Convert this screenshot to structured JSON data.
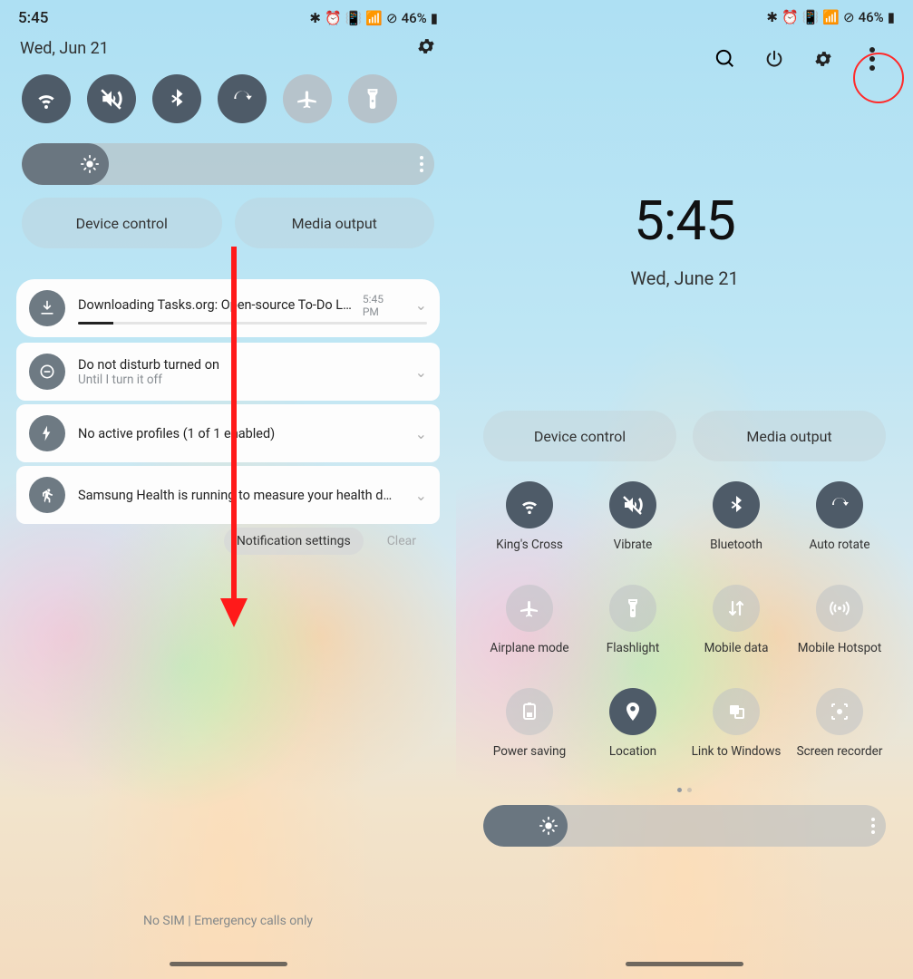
{
  "left": {
    "status": {
      "time": "5:45",
      "battery": "46%"
    },
    "date": "Wed, Jun 21",
    "toggles": [
      {
        "name": "wifi",
        "on": true
      },
      {
        "name": "sound",
        "on": true
      },
      {
        "name": "bluetooth",
        "on": true
      },
      {
        "name": "rotate",
        "on": true
      },
      {
        "name": "airplane",
        "on": false
      },
      {
        "name": "flashlight",
        "on": false
      }
    ],
    "pill_device": "Device control",
    "pill_media": "Media output",
    "notifications": [
      {
        "title": "Downloading Tasks.org: Open-source To-Do Lists &…",
        "time": "5:45 PM",
        "progress": 10
      },
      {
        "title": "Do not disturb turned on",
        "sub": "Until I turn it off"
      },
      {
        "title": "No active profiles (1 of 1 enabled)"
      },
      {
        "title": "Samsung Health is running to measure your health data."
      }
    ],
    "notif_settings": "Notification settings",
    "clear": "Clear",
    "nosim": "No SIM | Emergency calls only"
  },
  "right": {
    "status": {
      "battery": "46%"
    },
    "time": "5:45",
    "date": "Wed, June 21",
    "pill_device": "Device control",
    "pill_media": "Media output",
    "tiles": [
      {
        "label": "King's Cross",
        "icon": "wifi",
        "on": true
      },
      {
        "label": "Vibrate",
        "icon": "sound",
        "on": true
      },
      {
        "label": "Bluetooth",
        "icon": "bluetooth",
        "on": true
      },
      {
        "label": "Auto rotate",
        "icon": "rotate",
        "on": true
      },
      {
        "label": "Airplane mode",
        "icon": "airplane",
        "on": false
      },
      {
        "label": "Flashlight",
        "icon": "flashlight",
        "on": false
      },
      {
        "label": "Mobile data",
        "icon": "data",
        "on": false
      },
      {
        "label": "Mobile Hotspot",
        "icon": "hotspot",
        "on": false
      },
      {
        "label": "Power saving",
        "icon": "power",
        "on": false
      },
      {
        "label": "Location",
        "icon": "location",
        "on": true
      },
      {
        "label": "Link to Windows",
        "icon": "link",
        "on": false
      },
      {
        "label": "Screen recorder",
        "icon": "record",
        "on": false
      }
    ]
  }
}
